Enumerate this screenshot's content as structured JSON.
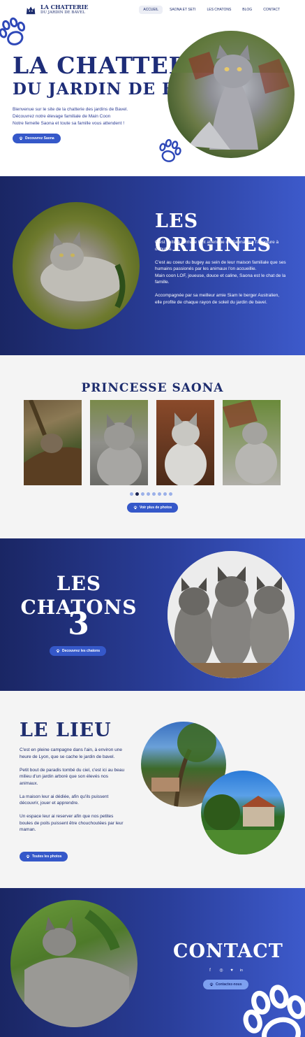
{
  "header": {
    "logo_line1": "LA CHATTERIE",
    "logo_line2": "DU JARDIN DE BAVEL",
    "nav": [
      "ACCUEIL",
      "SAONA ET SETI",
      "LES CHATONS",
      "BLOG",
      "CONTACT"
    ]
  },
  "hero": {
    "title1": "LA CHATTERIE",
    "title2": "DU JARDIN DE BAVEL",
    "line1": "Bienvenue sur le site de la chatterie des jardins de Bavel.",
    "line2": "Découvrez notre élevage familiale de Main Coon",
    "line3": "Notre femelle Saona et toute sa famille vous attendent !",
    "button": "Decouvrez Saona"
  },
  "origins": {
    "title": "LES ORIGINES",
    "p1": "C'est suite à l'arrivée tant attendue de Saona que l'aventure à débutée.",
    "p2": "C'est au coeur du bugey au sein de leur maison familiale que ses humains passionés par les animaux l'on accueillie.",
    "p3": "Main coon LOF, joueuse, douce et caline, Saona est le chat de la famille.",
    "p4": "Accompagnée par sa meilleur amie Siam le berger Australien, elle profite de chaque rayon de soleil du jardin de bavel."
  },
  "princesse": {
    "title": "PRINCESSE SAONA",
    "button": "Voir plus de photos",
    "active_dot": 1,
    "dot_count": 8
  },
  "chatons": {
    "title": "LES CHATONS",
    "count": "3",
    "button": "Decouvrez les chatons"
  },
  "lieu": {
    "title": "LE LIEU",
    "p1": "C'est en pleine campagne dans l'ain, à environ une heure de Lyon, que se cache le jardin de bavel.",
    "p2": "Petit bout de paradis tombé du ciel, c'est ici au beau milieu d'un jardin arboré que son élevés nos animaux.",
    "p3": "La maison leur ai dédiée, afin qu'ils puissent découvrir, jouer et apprendre.",
    "p4": "Un espace leur ai reserver afin que nos petites boules de poils puissent être chouchoutées par leur maman.",
    "button": "Toutes les photos"
  },
  "contact": {
    "title": "CONTACT",
    "social": [
      "f",
      "◎",
      "♥",
      "in"
    ],
    "button": "Contactez-nous"
  },
  "colors": {
    "navy": "#1e2d78",
    "accent": "#3558c9",
    "gradient_start": "#1a2664",
    "gradient_end": "#3d5acb"
  }
}
